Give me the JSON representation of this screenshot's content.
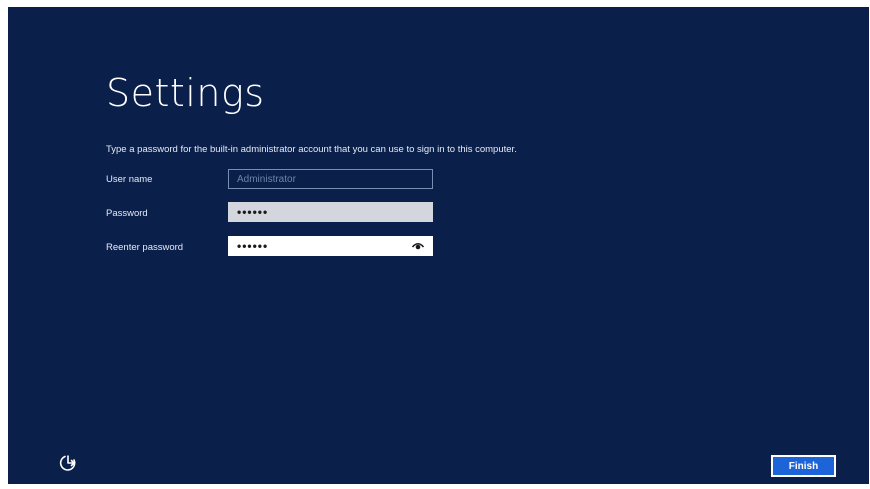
{
  "page": {
    "title": "Settings",
    "instruction": "Type a password for the built-in administrator account that you can use to sign in to this computer."
  },
  "form": {
    "username": {
      "label": "User name",
      "placeholder": "Administrator",
      "value": ""
    },
    "password": {
      "label": "Password",
      "masked_value": "••••••"
    },
    "reenter_password": {
      "label": "Reenter password",
      "masked_value": "••••••"
    }
  },
  "footer": {
    "finish_label": "Finish",
    "ease_of_access_icon": "ease-of-access-icon"
  },
  "colors": {
    "background": "#0a1f4a",
    "accent_button": "#1d64d8",
    "text": "#ffffff"
  }
}
